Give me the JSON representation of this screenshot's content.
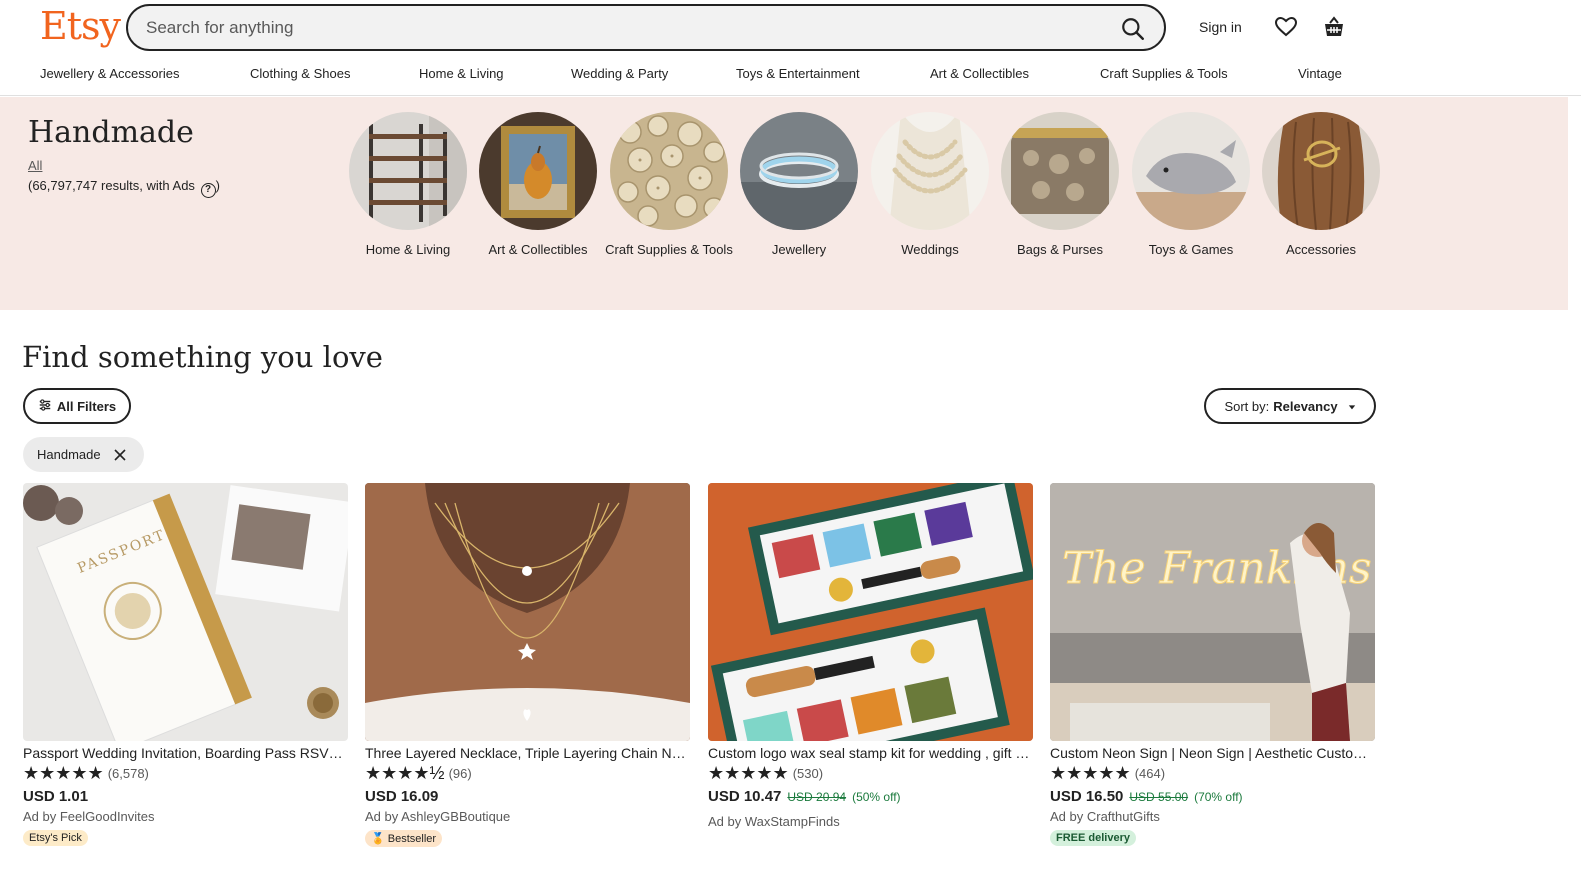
{
  "header": {
    "logo": "Etsy",
    "search_placeholder": "Search for anything",
    "signin": "Sign in"
  },
  "nav": [
    "Jewellery & Accessories",
    "Clothing & Shoes",
    "Home & Living",
    "Wedding & Party",
    "Toys & Entertainment",
    "Art & Collectibles",
    "Craft Supplies & Tools",
    "Vintage"
  ],
  "band": {
    "title": "Handmade",
    "all_link": "All",
    "results": "(66,797,747 results, with Ads",
    "results_end": ")",
    "help": "?",
    "categories": [
      "Home & Living",
      "Art & Collectibles",
      "Craft Supplies & Tools",
      "Jewellery",
      "Weddings",
      "Bags & Purses",
      "Toys & Games",
      "Accessories"
    ]
  },
  "main": {
    "title": "Find something you love",
    "filters": "All Filters",
    "sort_prefix": "Sort by:",
    "sort_value": "Relevancy",
    "chip": "Handmade"
  },
  "listings": [
    {
      "title": "Passport Wedding Invitation, Boarding Pass RSVP Card, Wedding Ticket",
      "stars": "★★★★★",
      "count": "(6,578)",
      "price": "USD 1.01",
      "orig": "",
      "disc": "",
      "seller": "Ad by FeelGoodInvites",
      "badge": "Etsy's Pick"
    },
    {
      "title": "Three Layered Necklace, Triple Layering Chain Necklace Set",
      "stars": "★★★★½",
      "count": "(96)",
      "price": "USD 16.09",
      "orig": "",
      "disc": "",
      "seller": "Ad by AshleyGBBoutique",
      "badge": "Bestseller"
    },
    {
      "title": "Custom logo wax seal stamp kit for wedding , gift set",
      "stars": "★★★★★",
      "count": "(530)",
      "price": "USD 10.47",
      "orig": "USD 20.94",
      "disc": "(50% off)",
      "seller": "Ad by WaxStampFinds",
      "badge": ""
    },
    {
      "title": "Custom Neon Sign | Neon Sign | Aesthetic Custom Name Light",
      "stars": "★★★★★",
      "count": "(464)",
      "price": "USD 16.50",
      "orig": "USD 55.00",
      "disc": "(70% off)",
      "seller": "Ad by CrafthutGifts",
      "badge": "FREE delivery"
    }
  ],
  "colors": {
    "brand": "#f1641e",
    "band": "#f7e9e5",
    "sale": "#1b7a3d"
  }
}
